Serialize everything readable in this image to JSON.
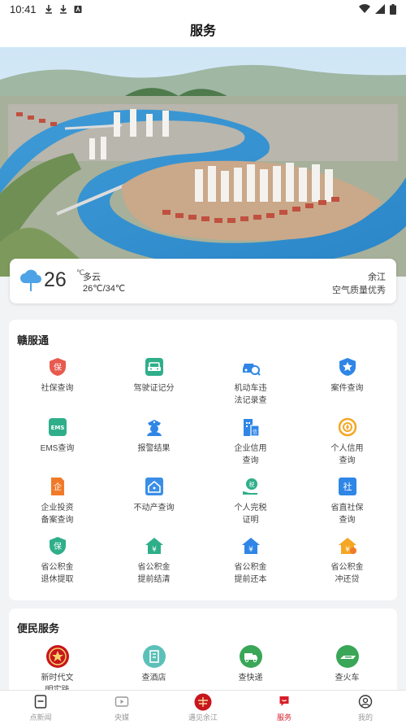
{
  "status_bar": {
    "time": "10:41"
  },
  "header": {
    "title": "服务"
  },
  "weather": {
    "temperature": "26",
    "unit": "℃",
    "condition": "多云",
    "range": "26℃/34℃",
    "city": "余江",
    "air_quality": "空气质量优秀"
  },
  "gan_fu_tong": {
    "title": "赣服通",
    "items": [
      {
        "label": "社保查询",
        "icon": "shield-icon",
        "color": "#e85a4f"
      },
      {
        "label": "驾驶证记分",
        "icon": "car-icon",
        "color": "#2fae8a"
      },
      {
        "label": "机动车违法记录查",
        "icon": "car-search-icon",
        "color": "#2f86e6"
      },
      {
        "label": "案件查询",
        "icon": "star-badge-icon",
        "color": "#2f86e6"
      },
      {
        "label": "EMS查询",
        "icon": "ems-icon",
        "color": "#2fae8a"
      },
      {
        "label": "报警结果",
        "icon": "police-icon",
        "color": "#2f86e6"
      },
      {
        "label": "企业信用查询",
        "icon": "building-icon",
        "color": "#2f86e6"
      },
      {
        "label": "个人信用查询",
        "icon": "credit-icon",
        "color": "#f5a623"
      },
      {
        "label": "企业投资备案查询",
        "icon": "invest-doc-icon",
        "color": "#f07a2a"
      },
      {
        "label": "不动产查询",
        "icon": "house-icon",
        "color": "#3a8ee6"
      },
      {
        "label": "个人完税证明",
        "icon": "tax-icon",
        "color": "#2fae8a"
      },
      {
        "label": "省直社保查询",
        "icon": "social-security-icon",
        "color": "#2f86e6"
      },
      {
        "label": "省公积金退休提取",
        "icon": "fund-shield-icon",
        "color": "#2fae8a"
      },
      {
        "label": "省公积金提前结清",
        "icon": "yen-house-icon",
        "color": "#2fae8a"
      },
      {
        "label": "省公积金提前还本",
        "icon": "yen-house-icon",
        "color": "#2f86e6"
      },
      {
        "label": "省公积金冲还贷",
        "icon": "yen-house-icon",
        "color": "#f5a623"
      }
    ]
  },
  "bian_min": {
    "title": "便民服务",
    "items": [
      {
        "label": "新时代文明实践",
        "icon": "civilization-logo-icon",
        "color": "#c8161d"
      },
      {
        "label": "查酒店",
        "icon": "hotel-icon",
        "color": "#5bc0b8"
      },
      {
        "label": "查快递",
        "icon": "delivery-truck-icon",
        "color": "#3aa657"
      },
      {
        "label": "查火车",
        "icon": "train-icon",
        "color": "#3aa657"
      }
    ]
  },
  "bottom_nav": [
    {
      "label": "点新闻",
      "icon": "news-icon",
      "active": false
    },
    {
      "label": "央媒",
      "icon": "video-icon",
      "active": false
    },
    {
      "label": "遇见余江",
      "icon": "yujian-logo-icon",
      "active": false
    },
    {
      "label": "服务",
      "icon": "service-icon",
      "active": true
    },
    {
      "label": "我的",
      "icon": "profile-icon",
      "active": false
    }
  ]
}
